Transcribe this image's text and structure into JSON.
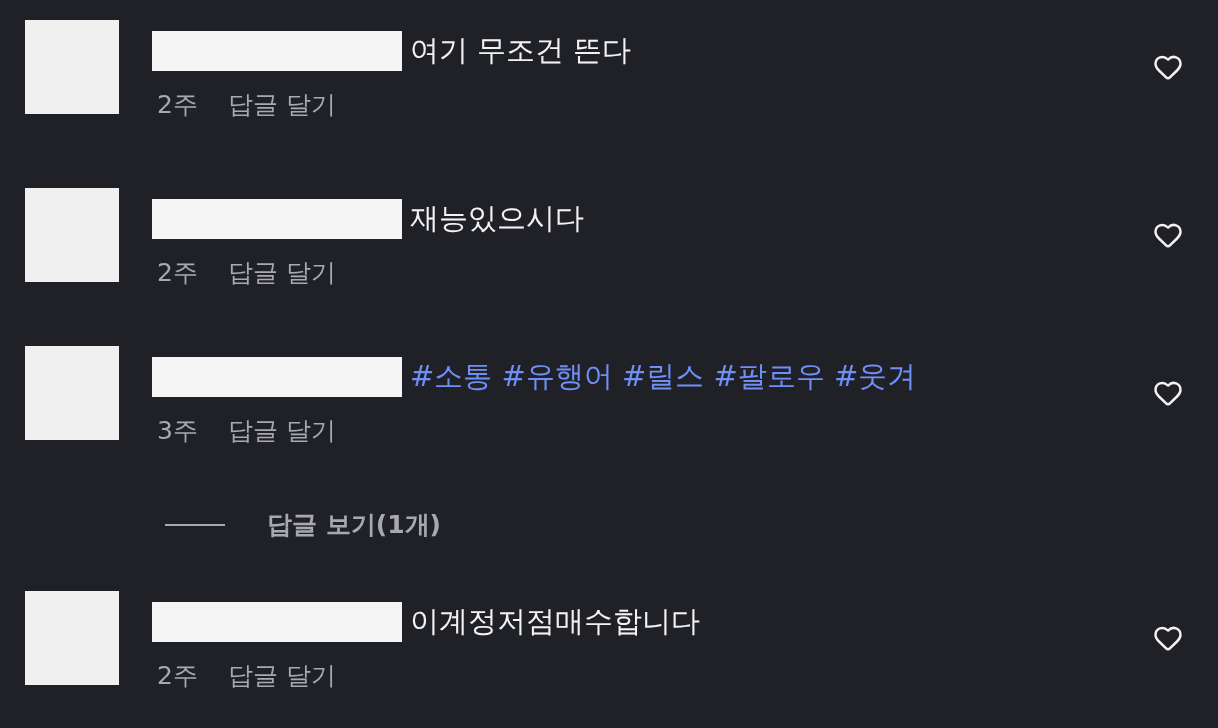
{
  "comments": [
    {
      "kind": "plain",
      "text": "여기 무조건 뜬다",
      "time": "2주",
      "reply_label": "답글 달기",
      "liked": false
    },
    {
      "kind": "plain",
      "text": "재능있으시다",
      "time": "2주",
      "reply_label": "답글 달기",
      "liked": false
    },
    {
      "kind": "hashtag",
      "text": "#소통 #유행어 #릴스 #팔로우 #웃겨",
      "time": "3주",
      "reply_label": "답글 달기",
      "liked": false,
      "replies_toggle": "답글 보기(1개)"
    },
    {
      "kind": "plain",
      "text": "이계정저점매수합니다",
      "time": "2주",
      "reply_label": "답글 달기",
      "liked": false
    }
  ]
}
